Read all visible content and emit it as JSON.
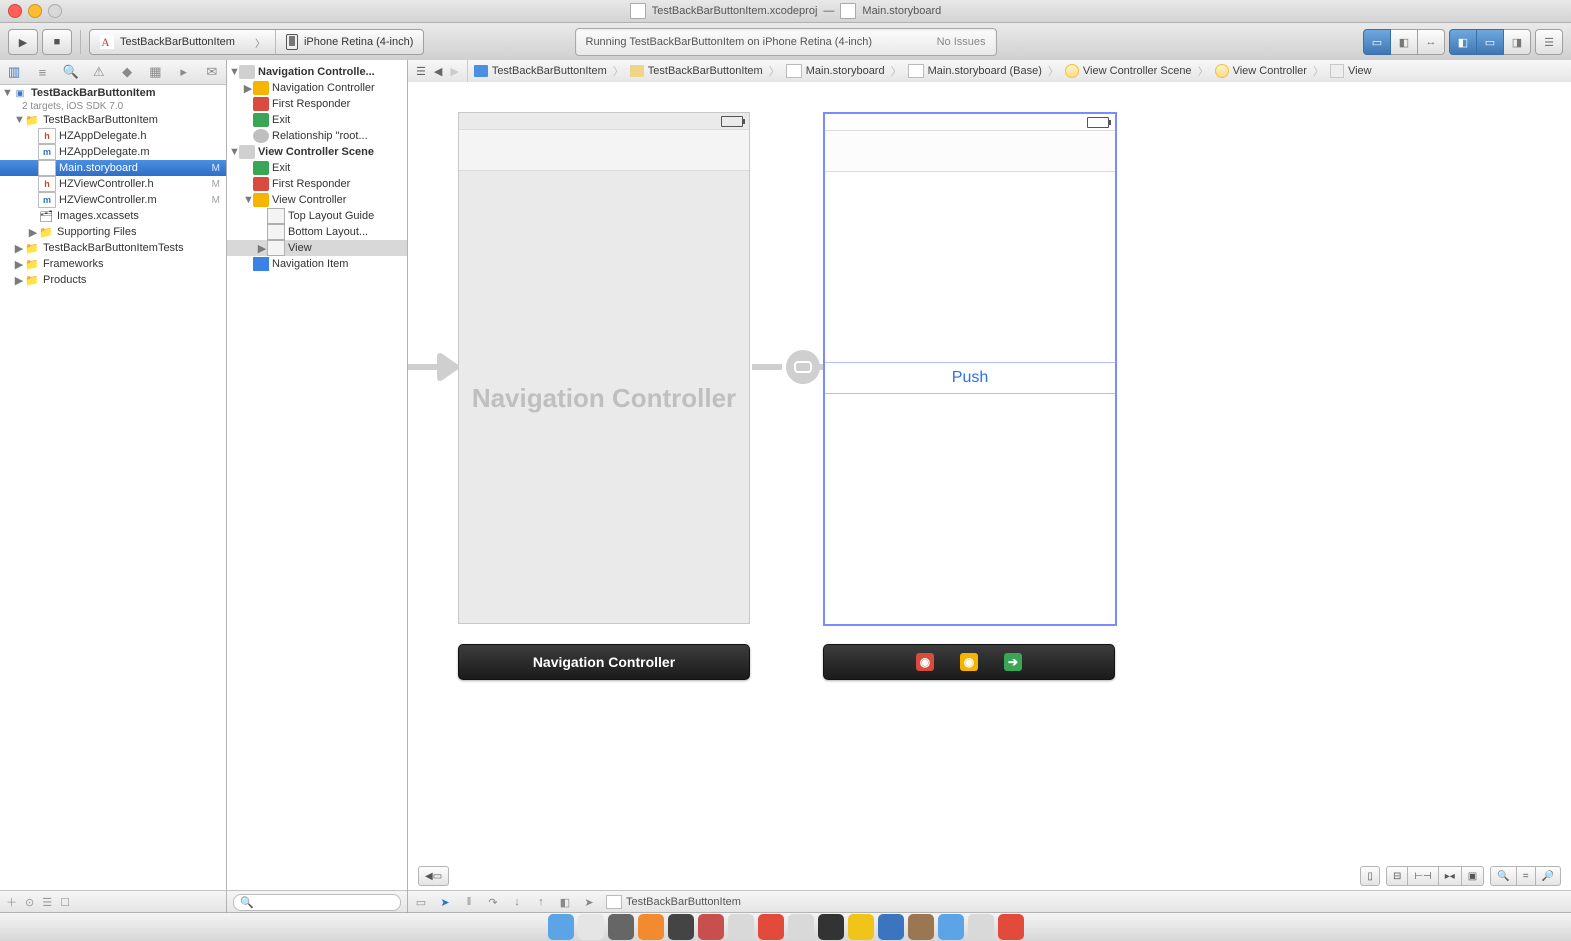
{
  "window": {
    "project_doc": "TestBackBarButtonItem.xcodeproj",
    "divider": "—",
    "file_doc": "Main.storyboard"
  },
  "toolbar": {
    "scheme_app": "TestBackBarButtonItem",
    "scheme_device": "iPhone Retina (4-inch)",
    "activity_status": "Running TestBackBarButtonItem on iPhone Retina (4-inch)",
    "activity_right": "No Issues"
  },
  "navigator": {
    "project": "TestBackBarButtonItem",
    "subtitle": "2 targets, iOS SDK 7.0",
    "group": "TestBackBarButtonItem",
    "files": [
      {
        "name": "HZAppDelegate.h",
        "type": "h"
      },
      {
        "name": "HZAppDelegate.m",
        "type": "m"
      },
      {
        "name": "Main.storyboard",
        "type": "sb",
        "sel": true,
        "badge": "M"
      },
      {
        "name": "HZViewController.h",
        "type": "h",
        "badge": "M"
      },
      {
        "name": "HZViewController.m",
        "type": "m",
        "badge": "M"
      },
      {
        "name": "Images.xcassets",
        "type": "xc"
      }
    ],
    "supporting": "Supporting Files",
    "tests": "TestBackBarButtonItemTests",
    "frameworks": "Frameworks",
    "products": "Products"
  },
  "outline": {
    "scenes": [
      {
        "title": "Navigation Controlle...",
        "children": [
          {
            "icon": "yellow",
            "label": "Navigation Controller",
            "disc": true
          },
          {
            "icon": "red",
            "label": "First Responder"
          },
          {
            "icon": "green",
            "label": "Exit"
          },
          {
            "icon": "gray",
            "label": "Relationship \"root..."
          }
        ]
      },
      {
        "title": "View Controller Scene",
        "children": [
          {
            "icon": "green",
            "label": "Exit"
          },
          {
            "icon": "red",
            "label": "First Responder"
          },
          {
            "icon": "yellow",
            "label": "View Controller",
            "disc": true,
            "children": [
              {
                "icon": "box",
                "label": "Top Layout Guide"
              },
              {
                "icon": "box",
                "label": "Bottom Layout..."
              },
              {
                "icon": "box",
                "label": "View",
                "sel": true,
                "disc": true
              }
            ]
          },
          {
            "icon": "blue",
            "label": "Navigation Item"
          }
        ]
      }
    ]
  },
  "jumpbar": [
    {
      "ico": "proj",
      "label": "TestBackBarButtonItem"
    },
    {
      "ico": "fold",
      "label": "TestBackBarButtonItem"
    },
    {
      "ico": "sb",
      "label": "Main.storyboard"
    },
    {
      "ico": "sb",
      "label": "Main.storyboard (Base)"
    },
    {
      "ico": "scene",
      "label": "View Controller Scene"
    },
    {
      "ico": "scene",
      "label": "View Controller"
    },
    {
      "ico": "view",
      "label": "View"
    }
  ],
  "canvas": {
    "nav_controller_label": "Navigation Controller",
    "push_label": "Push",
    "nav_bar_label": "Navigation Controller"
  },
  "debug": {
    "process": "TestBackBarButtonItem"
  }
}
